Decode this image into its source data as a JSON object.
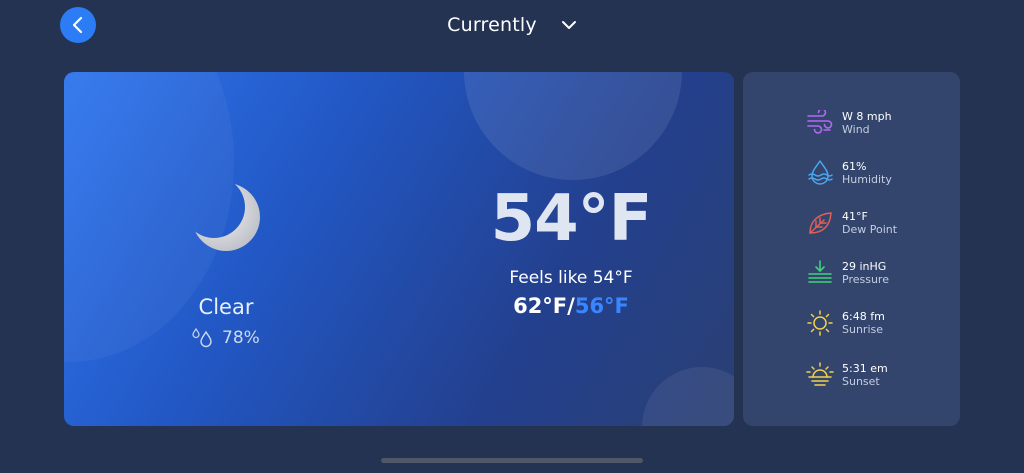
{
  "header": {
    "title": "Currently"
  },
  "current": {
    "condition": "Clear",
    "precip_chance": "78%",
    "temperature": "54°F",
    "feels_like": "Feels like 54°F",
    "high": "62°F",
    "separator": "/",
    "low": "56°F"
  },
  "details": [
    {
      "icon": "wind-icon",
      "value": "W 8 mph",
      "label": "Wind",
      "color": "#b06bf0"
    },
    {
      "icon": "humidity-icon",
      "value": "61%",
      "label": "Humidity",
      "color": "#4aa6f0"
    },
    {
      "icon": "dew-point-icon",
      "value": "41°F",
      "label": "Dew Point",
      "color": "#e0605a"
    },
    {
      "icon": "pressure-icon",
      "value": "29 inHG",
      "label": "Pressure",
      "color": "#3fd17a"
    },
    {
      "icon": "sunrise-icon",
      "value": "6:48 fm",
      "label": "Sunrise",
      "color": "#f2d14b"
    },
    {
      "icon": "sunset-icon",
      "value": "5:31 em",
      "label": "Sunset",
      "color": "#f2d14b"
    }
  ],
  "colors": {
    "accent": "#2b7cf5",
    "low_temp": "#3a86ff",
    "background": "#243352",
    "side_card": "#33456d"
  }
}
